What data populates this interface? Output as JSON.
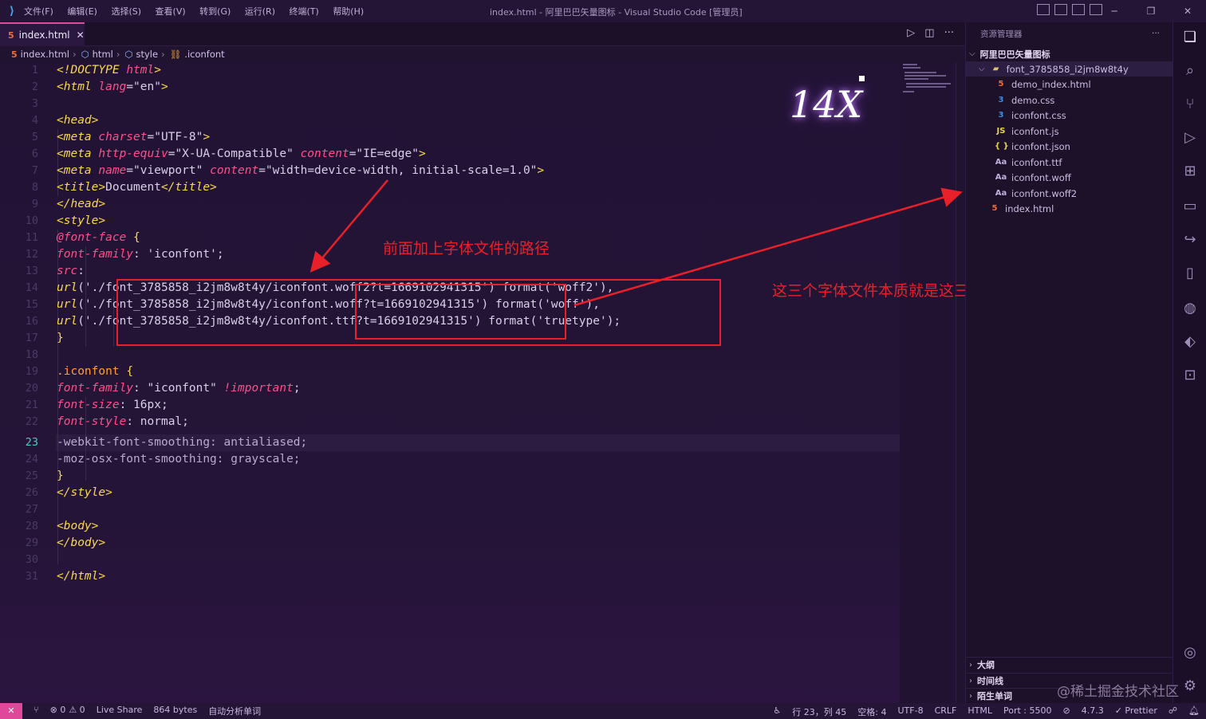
{
  "titlebar": {
    "menus": [
      "文件(F)",
      "编辑(E)",
      "选择(S)",
      "查看(V)",
      "转到(G)",
      "运行(R)",
      "终端(T)",
      "帮助(H)"
    ],
    "title": "index.html - 阿里巴巴矢量图标 - Visual Studio Code [管理员]",
    "minimize": "─",
    "restore": "❐",
    "close": "✕"
  },
  "tab": {
    "icon": "5",
    "label": "index.html",
    "close": "✕"
  },
  "tab_actions": {
    "run": "▷",
    "split": "◫",
    "more": "···"
  },
  "breadcrumb": {
    "file": "index.html",
    "html": "html",
    "style": "style",
    "selector": ".iconfont"
  },
  "editor": {
    "line_numbers": [
      "1",
      "2",
      "3",
      "4",
      "5",
      "6",
      "7",
      "8",
      "9",
      "10",
      "11",
      "12",
      "13",
      "14",
      "15",
      "16",
      "17",
      "18",
      "19",
      "20",
      "21",
      "22",
      "23",
      "24",
      "25",
      "26",
      "27",
      "28",
      "29",
      "30",
      "31"
    ],
    "active_line": "23"
  },
  "annotations": {
    "zoom_label": "14X",
    "path_note": "前面加上字体文件的路径",
    "files_note": "这三个字体文件本质就是这三个文件"
  },
  "explorer": {
    "header": "资源管理器",
    "more": "···",
    "root": "阿里巴巴矢量图标",
    "folder": "font_3785858_i2jm8w8t4y",
    "files": [
      {
        "name": "demo_index.html",
        "icon": "5"
      },
      {
        "name": "demo.css",
        "icon": "3"
      },
      {
        "name": "iconfont.css",
        "icon": "3"
      },
      {
        "name": "iconfont.js",
        "icon": "JS"
      },
      {
        "name": "iconfont.json",
        "icon": "{ }"
      },
      {
        "name": "iconfont.ttf",
        "icon": "Aa"
      },
      {
        "name": "iconfont.woff",
        "icon": "Aa"
      },
      {
        "name": "iconfont.woff2",
        "icon": "Aa"
      }
    ],
    "root_file": {
      "name": "index.html",
      "icon": "5"
    },
    "sections": [
      "大纲",
      "时间线",
      "陌生单词"
    ]
  },
  "statusbar": {
    "errors": "⊗ 0",
    "warnings": "⚠ 0",
    "live_share": "Live Share",
    "bytes": "864 bytes",
    "analyze": "自动分析单词",
    "position": "行 23，列 45",
    "spaces": "空格: 4",
    "encoding": "UTF-8",
    "eol": "CRLF",
    "language": "HTML",
    "port": "Port : 5500",
    "version": "4.7.3",
    "prettier": "✓ Prettier"
  },
  "watermark": "@稀土掘金技术社区",
  "colors": {
    "background": "#1f1330",
    "accent": "#e0489a",
    "annotation_red": "#e8202a",
    "tag": "#f9d84a",
    "attribute": "#ff4f8b"
  }
}
